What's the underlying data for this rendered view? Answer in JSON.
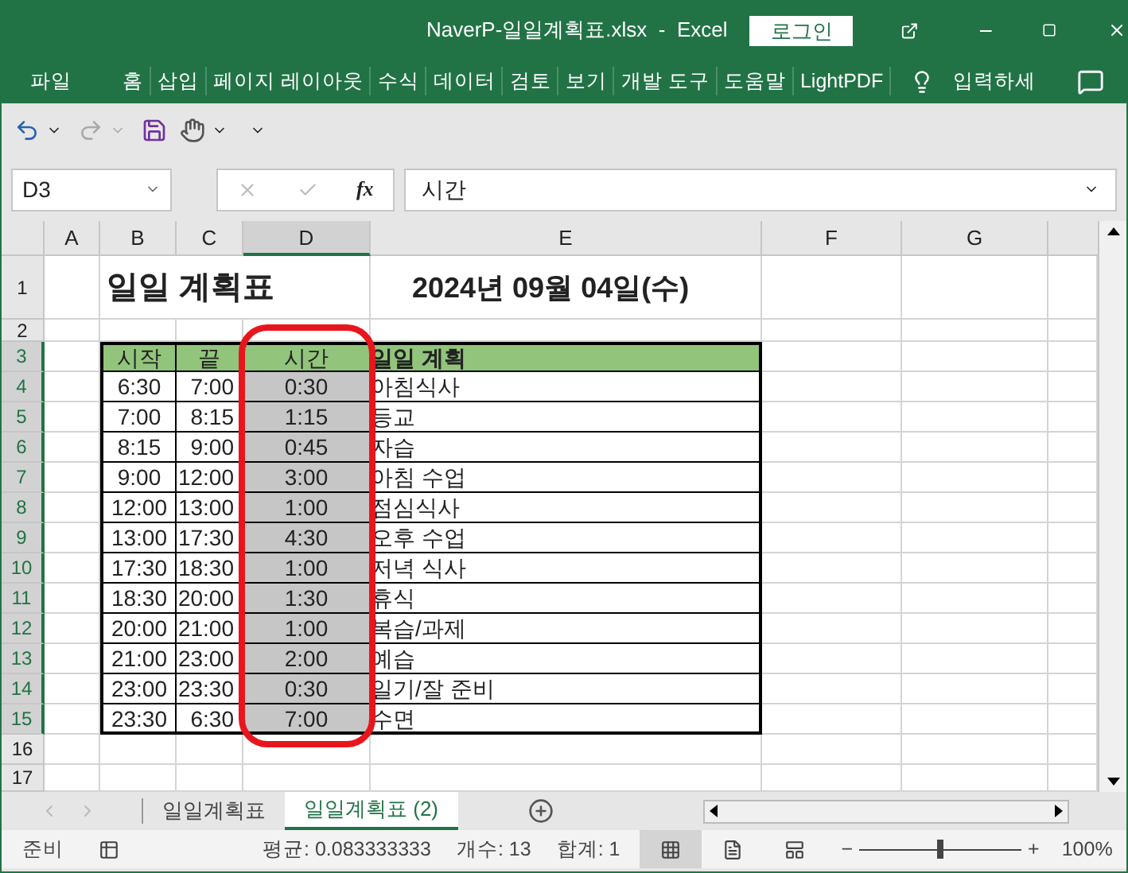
{
  "window": {
    "title": "NaverP-일일계획표.xlsx  -  Excel",
    "login": "로그인"
  },
  "ribbon": {
    "tabs": [
      "파일",
      "홈",
      "삽입",
      "페이지 레이아웃",
      "수식",
      "데이터",
      "검토",
      "보기",
      "개발 도구",
      "도움말",
      "LightPDF"
    ],
    "tell_me": "입력하세"
  },
  "formula_bar": {
    "name_box": "D3",
    "fx": "fx",
    "value": "시간"
  },
  "columns": [
    {
      "label": "A",
      "selected": false
    },
    {
      "label": "B",
      "selected": false
    },
    {
      "label": "C",
      "selected": false
    },
    {
      "label": "D",
      "selected": true
    },
    {
      "label": "E",
      "selected": false
    },
    {
      "label": "F",
      "selected": false
    },
    {
      "label": "G",
      "selected": false
    }
  ],
  "row_headers": [
    {
      "label": "1",
      "selected": false
    },
    {
      "label": "2",
      "selected": false
    },
    {
      "label": "3",
      "selected": true
    },
    {
      "label": "4",
      "selected": true
    },
    {
      "label": "5",
      "selected": true
    },
    {
      "label": "6",
      "selected": true
    },
    {
      "label": "7",
      "selected": true
    },
    {
      "label": "8",
      "selected": true
    },
    {
      "label": "9",
      "selected": true
    },
    {
      "label": "10",
      "selected": true
    },
    {
      "label": "11",
      "selected": true
    },
    {
      "label": "12",
      "selected": true
    },
    {
      "label": "13",
      "selected": true
    },
    {
      "label": "14",
      "selected": true
    },
    {
      "label": "15",
      "selected": true
    },
    {
      "label": "16",
      "selected": false
    },
    {
      "label": "17",
      "selected": false
    }
  ],
  "title_cell": "일일 계획표",
  "date_cell": "2024년 09월 04일(수)",
  "schedule": {
    "headers": [
      "시작",
      "끝",
      "시간",
      "일일 계획"
    ],
    "rows": [
      {
        "start": "6:30",
        "end": "7:00",
        "duration": "0:30",
        "plan": "아침식사",
        "selected": true
      },
      {
        "start": "7:00",
        "end": "8:15",
        "duration": "1:15",
        "plan": "등교",
        "selected": true
      },
      {
        "start": "8:15",
        "end": "9:00",
        "duration": "0:45",
        "plan": "자습",
        "selected": true
      },
      {
        "start": "9:00",
        "end": "12:00",
        "duration": "3:00",
        "plan": "아침 수업",
        "selected": true
      },
      {
        "start": "12:00",
        "end": "13:00",
        "duration": "1:00",
        "plan": "점심식사",
        "selected": true
      },
      {
        "start": "13:00",
        "end": "17:30",
        "duration": "4:30",
        "plan": "오후 수업",
        "selected": true
      },
      {
        "start": "17:30",
        "end": "18:30",
        "duration": "1:00",
        "plan": "저녁 식사",
        "selected": true
      },
      {
        "start": "18:30",
        "end": "20:00",
        "duration": "1:30",
        "plan": "휴식",
        "selected": true
      },
      {
        "start": "20:00",
        "end": "21:00",
        "duration": "1:00",
        "plan": "복습/과제",
        "selected": true
      },
      {
        "start": "21:00",
        "end": "23:00",
        "duration": "2:00",
        "plan": "예습",
        "selected": true
      },
      {
        "start": "23:00",
        "end": "23:30",
        "duration": "0:30",
        "plan": "일기/잘 준비",
        "selected": true
      },
      {
        "start": "23:30",
        "end": "6:30",
        "duration": "7:00",
        "plan": "수면",
        "selected": true
      }
    ]
  },
  "sheet_tabs": [
    {
      "label": "일일계획표",
      "selected": false
    },
    {
      "label": "일일계획표 (2)",
      "selected": true
    }
  ],
  "status_bar": {
    "ready": "준비",
    "average": "평균: 0.083333333",
    "count": "개수: 13",
    "sum": "합계: 1",
    "views": [
      {
        "kind": "normal",
        "selected": true
      },
      {
        "kind": "page-layout",
        "selected": false
      },
      {
        "kind": "page-break",
        "selected": false
      }
    ],
    "zoom_minus": "−",
    "zoom_plus": "+",
    "zoom": {
      "level": 0.5
    },
    "zoom_text": "100%"
  }
}
